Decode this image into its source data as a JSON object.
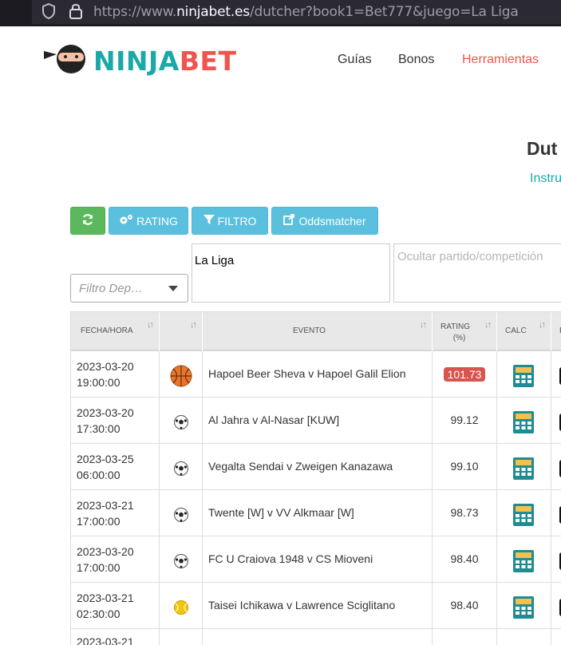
{
  "browser": {
    "url_prefix": "https://www.",
    "url_domain": "ninjabet.es",
    "url_path": "/dutcher?book1=Bet777&juego=La Liga"
  },
  "header": {
    "logo_ninja": "NINJA",
    "logo_bet": "BET",
    "nav": [
      {
        "label": "Guías",
        "active": false
      },
      {
        "label": "Bonos",
        "active": false
      },
      {
        "label": "Herramientas",
        "active": true
      }
    ]
  },
  "page": {
    "title": "Dut",
    "instructions_link": "Instru"
  },
  "toolbar": {
    "refresh_icon": "refresh-icon",
    "rating_label": "RATING",
    "filtro_label": "FILTRO",
    "oddsmatcher_label": "Oddsmatcher"
  },
  "filters": {
    "deporte_placeholder": "Filtro Dep…",
    "liga_value": "La Liga",
    "hide_placeholder": "Ocultar partido/competición"
  },
  "table": {
    "headers": {
      "fecha": "FECHA/HORA",
      "evento": "EVENTO",
      "rating_line1": "RATING",
      "rating_line2": "(%)",
      "calc": "CALC",
      "extra": "E"
    },
    "rows": [
      {
        "date": "2023-03-20",
        "time": "19:00:00",
        "sport": "basketball",
        "event": "Hapoel Beer Sheva v Hapoel Galil Elion",
        "rating": "101.73",
        "highlight": true
      },
      {
        "date": "2023-03-20",
        "time": "17:30:00",
        "sport": "soccer",
        "event": "Al Jahra v Al-Nasar [KUW]",
        "rating": "99.12",
        "highlight": false
      },
      {
        "date": "2023-03-25",
        "time": "06:00:00",
        "sport": "soccer",
        "event": "Vegalta Sendai v Zweigen Kanazawa",
        "rating": "99.10",
        "highlight": false
      },
      {
        "date": "2023-03-21",
        "time": "17:00:00",
        "sport": "soccer",
        "event": "Twente [W] v VV Alkmaar [W]",
        "rating": "98.73",
        "highlight": false
      },
      {
        "date": "2023-03-20",
        "time": "17:00:00",
        "sport": "soccer",
        "event": "FC U Craiova 1948 v CS Mioveni",
        "rating": "98.40",
        "highlight": false
      },
      {
        "date": "2023-03-21",
        "time": "02:30:00",
        "sport": "tennis",
        "event": "Taisei Ichikawa v Lawrence Sciglitano",
        "rating": "98.40",
        "highlight": false
      }
    ],
    "partial_row_date": "2023-03-21"
  },
  "colors": {
    "brand_teal": "#1aa9a6",
    "brand_red": "#f0544f",
    "btn_green": "#5cb85c",
    "btn_info": "#5bc0de",
    "rating_highlight": "#d9534f"
  }
}
